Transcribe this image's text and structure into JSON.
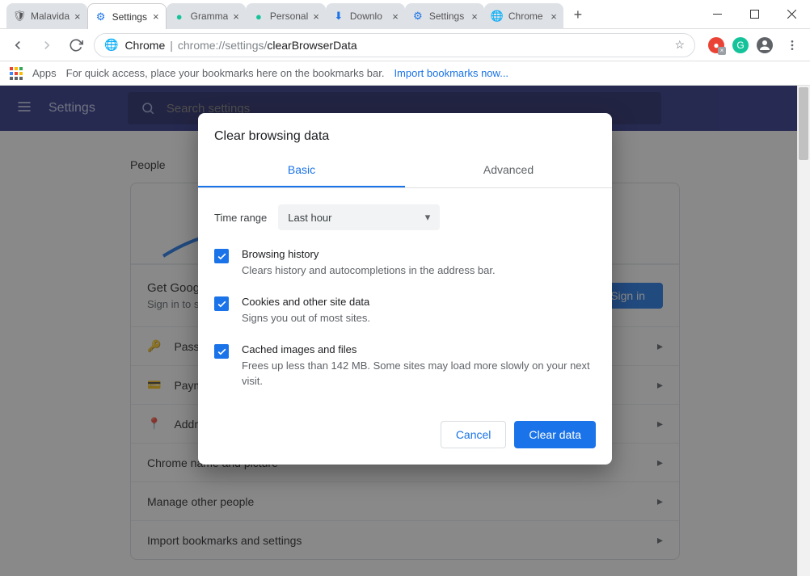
{
  "window": {
    "tabs": [
      {
        "title": "Malavida",
        "favicon": "🛡",
        "active": false
      },
      {
        "title": "Settings",
        "favicon": "⚙",
        "active": true
      },
      {
        "title": "Gramma",
        "favicon": "🟢",
        "active": false
      },
      {
        "title": "Personal",
        "favicon": "🟢",
        "active": false
      },
      {
        "title": "Downlo",
        "favicon": "⬇",
        "active": false
      },
      {
        "title": "Settings",
        "favicon": "⚙",
        "active": false
      },
      {
        "title": "Chrome",
        "favicon": "🌐",
        "active": false
      }
    ]
  },
  "omnibox": {
    "secure_label": "Chrome",
    "url_prefix": "chrome://settings/",
    "url_suffix": "clearBrowserData"
  },
  "bookmarks_bar": {
    "apps_label": "Apps",
    "hint": "For quick access, place your bookmarks here on the bookmarks bar.",
    "import_link": "Import bookmarks now..."
  },
  "settings_page": {
    "app_title": "Settings",
    "search_placeholder": "Search settings",
    "section": "People",
    "signin_heading": "Get Google smarts in Chrome",
    "signin_sub": "Sign in to sync and personalize Chrome across your devices",
    "signin_button": "Sign in",
    "rows": [
      "Passwords",
      "Payment methods",
      "Addresses and more",
      "Chrome name and picture",
      "Manage other people",
      "Import bookmarks and settings"
    ]
  },
  "dialog": {
    "title": "Clear browsing data",
    "tabs": {
      "basic": "Basic",
      "advanced": "Advanced"
    },
    "time_range_label": "Time range",
    "time_range_value": "Last hour",
    "items": [
      {
        "title": "Browsing history",
        "desc": "Clears history and autocompletions in the address bar.",
        "checked": true
      },
      {
        "title": "Cookies and other site data",
        "desc": "Signs you out of most sites.",
        "checked": true
      },
      {
        "title": "Cached images and files",
        "desc": "Frees up less than 142 MB. Some sites may load more slowly on your next visit.",
        "checked": true
      }
    ],
    "cancel": "Cancel",
    "confirm": "Clear data"
  }
}
